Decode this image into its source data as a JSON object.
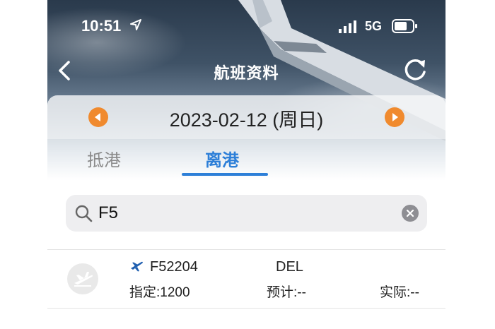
{
  "status_bar": {
    "time": "10:51",
    "network": "5G"
  },
  "nav": {
    "title": "航班资料"
  },
  "date_bar": {
    "date": "2023-02-12 (周日)"
  },
  "tabs": [
    {
      "label": "抵港",
      "selected": false
    },
    {
      "label": "离港",
      "selected": true
    }
  ],
  "search": {
    "value": "F5"
  },
  "flights": [
    {
      "flight_no": "F52204",
      "destination": "DEL",
      "scheduled": "指定:1200",
      "estimated": "预计:--",
      "actual": "实际:--"
    }
  ],
  "colors": {
    "accent": "#2d7fd8",
    "date_arrow": "#f08a2e",
    "flight_icon": "#1f5fb0"
  }
}
